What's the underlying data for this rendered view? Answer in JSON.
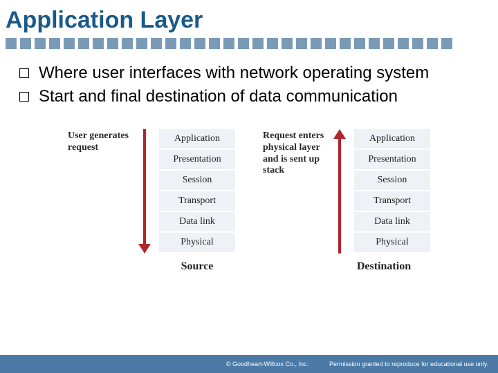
{
  "title": "Application Layer",
  "bullets": [
    "Where user interfaces with network operating system",
    "Start and final destination of data communication"
  ],
  "diagram": {
    "source": {
      "caption": "User generates request",
      "layers": [
        "Application",
        "Presentation",
        "Session",
        "Transport",
        "Data link",
        "Physical"
      ],
      "label": "Source",
      "arrow_direction": "down"
    },
    "destination": {
      "caption": "Request enters physical layer and is sent up stack",
      "layers": [
        "Application",
        "Presentation",
        "Session",
        "Transport",
        "Data link",
        "Physical"
      ],
      "label": "Destination",
      "arrow_direction": "up"
    }
  },
  "footer": {
    "copyright": "© Goodheart-Willcox Co., Inc.",
    "permission": "Permission granted to reproduce for educational use only."
  },
  "decor_square_count": 31
}
